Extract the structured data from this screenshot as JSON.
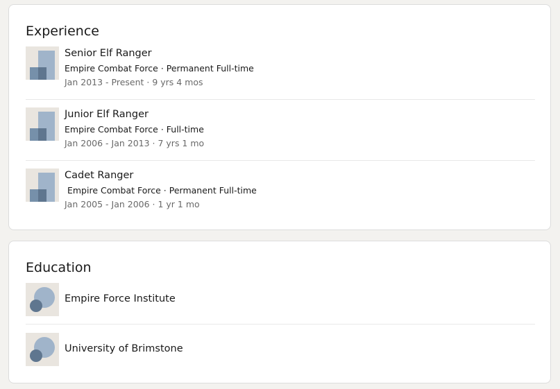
{
  "experience": {
    "title": "Experience",
    "items": [
      {
        "role": "Senior Elf Ranger",
        "org": "Empire Combat Force · Permanent Full-time",
        "dates": "Jan 2013 - Present · 9 yrs 4 mos",
        "logo_icon": "company-logo-icon"
      },
      {
        "role": "Junior Elf Ranger",
        "org": "Empire Combat Force · Full-time",
        "dates": "Jan 2006 - Jan 2013 · 7 yrs 1 mo",
        "logo_icon": "company-logo-icon"
      },
      {
        "role": "Cadet Ranger",
        "org": " Empire Combat Force · Permanent Full-time",
        "dates": "Jan 2005 - Jan 2006 · 1 yr 1 mo",
        "logo_icon": "company-logo-icon"
      }
    ]
  },
  "education": {
    "title": "Education",
    "items": [
      {
        "school": "Empire Force Institute",
        "logo_icon": "school-logo-icon"
      },
      {
        "school": "University of Brimstone",
        "logo_icon": "school-logo-icon"
      }
    ]
  },
  "colors": {
    "page_bg": "#f3f2ef",
    "card_bg": "#ffffff",
    "logo_bg": "#e9e5df",
    "logo_light": "#a0b4ca",
    "logo_dark": "#5f768f"
  }
}
